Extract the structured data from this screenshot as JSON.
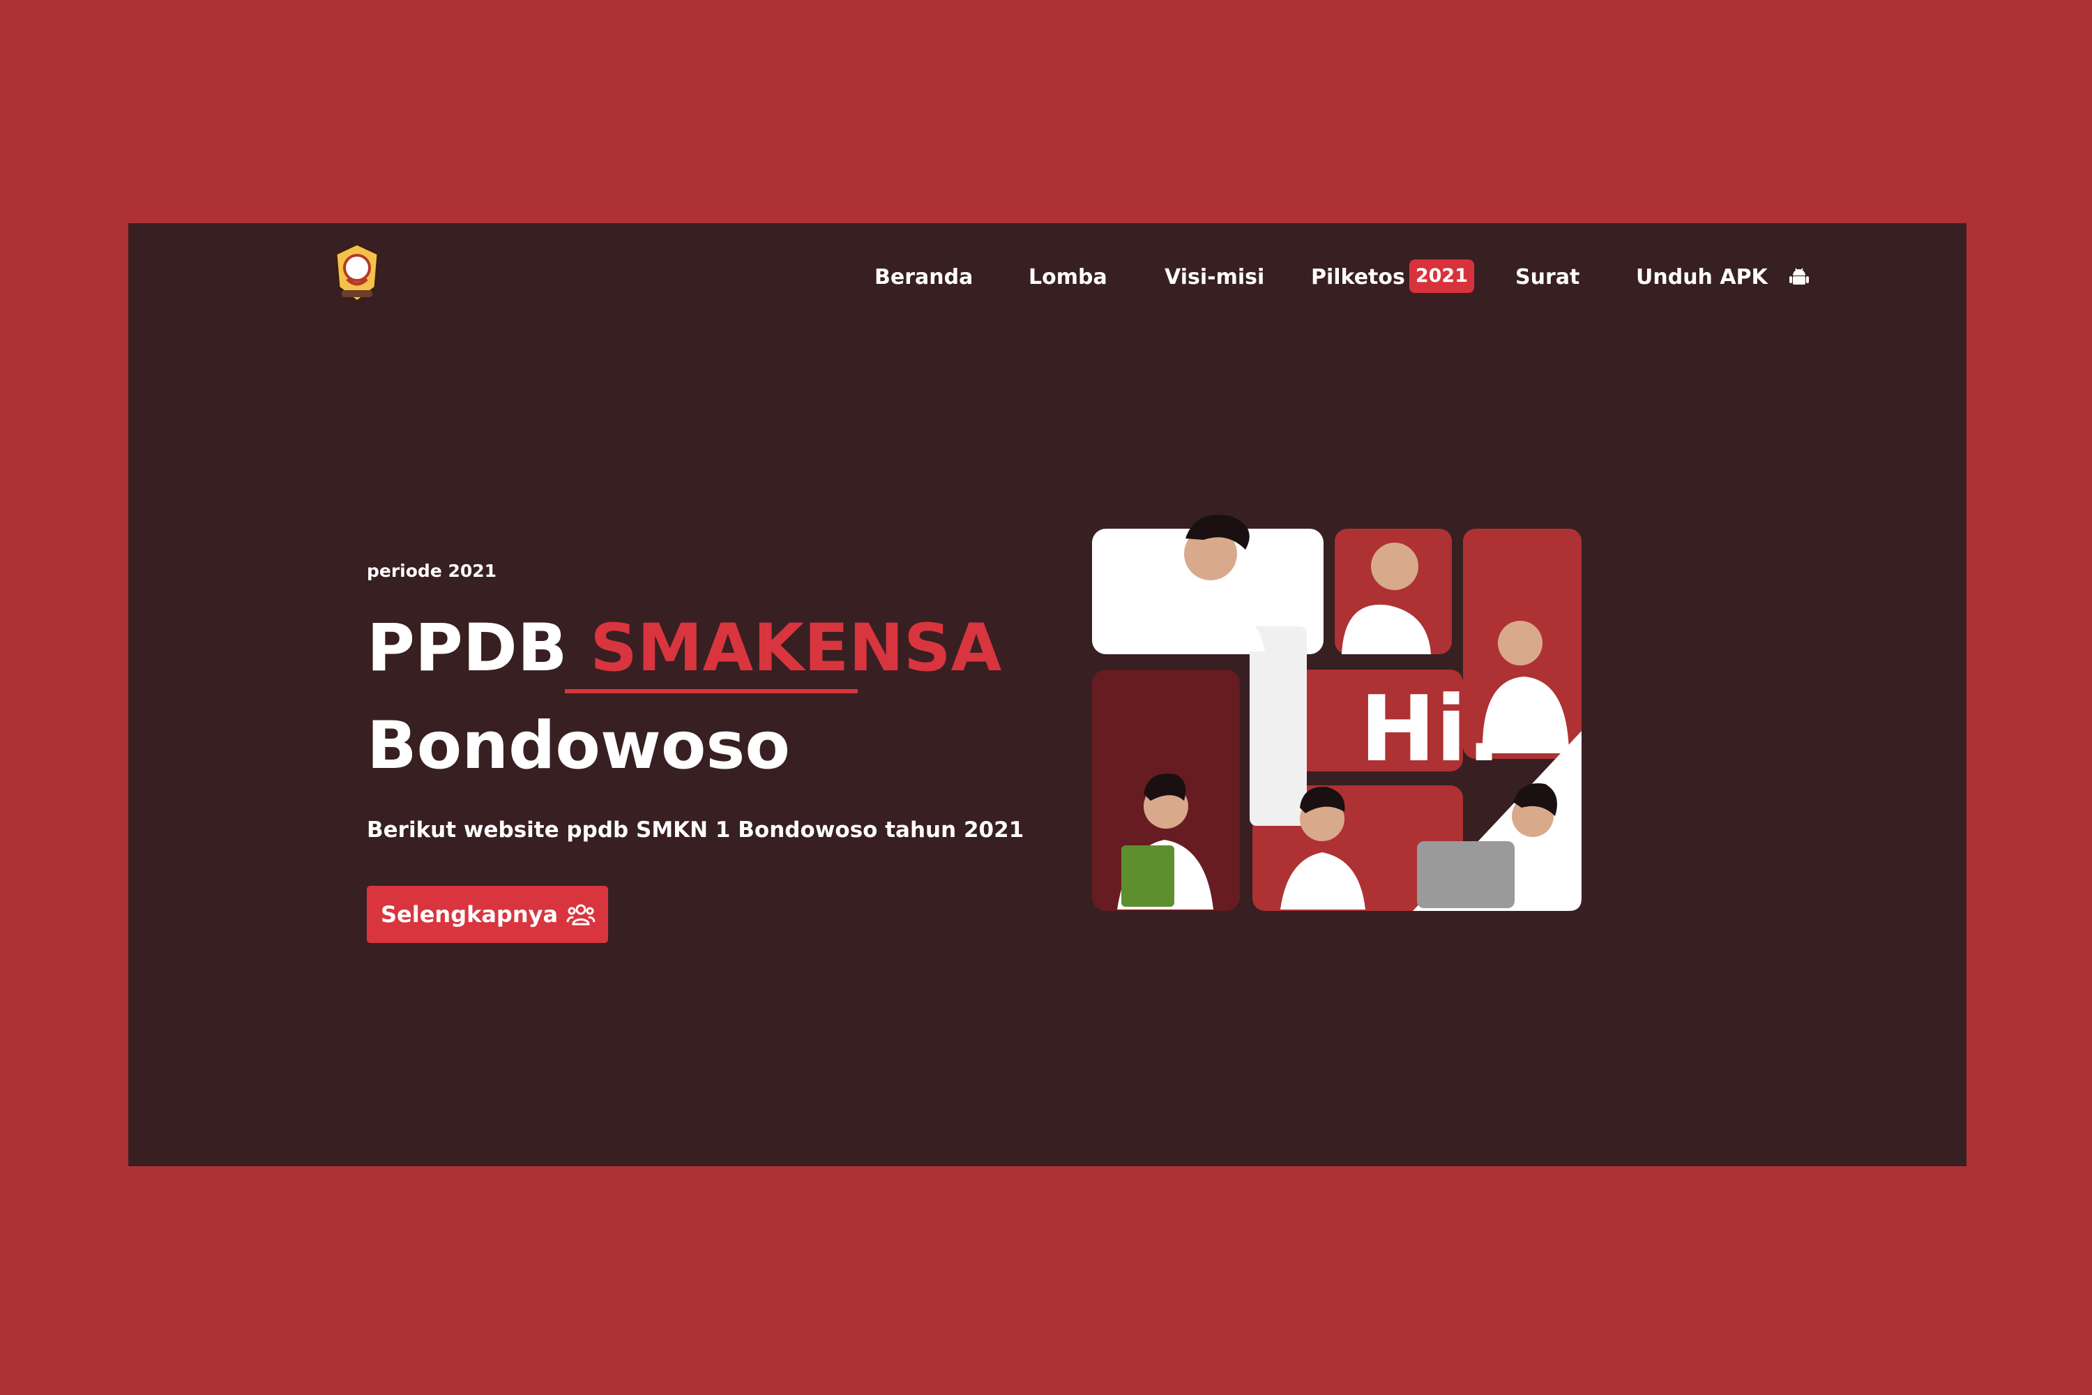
{
  "header": {
    "logo_icon": "school-emblem-icon",
    "nav": [
      {
        "label": "Beranda"
      },
      {
        "label": "Lomba"
      },
      {
        "label": "Visi-misi"
      },
      {
        "label": "Pilketos",
        "badge": "2021"
      },
      {
        "label": "Surat"
      },
      {
        "label": "Unduh APK",
        "icon": "android-icon"
      }
    ]
  },
  "hero": {
    "eyebrow": "periode 2021",
    "title_prefix": "PPDB",
    "title_accent": "SMAKENSA",
    "title_suffix": "Bondowoso",
    "subtitle": "Berikut website ppdb SMKN 1 Bondowoso tahun 2021",
    "cta_label": "Selengkapnya",
    "cta_icon": "users-icon",
    "illustration_text": "Hi."
  },
  "colors": {
    "outer_background": "#ae3234",
    "page_background": "#381f22",
    "accent": "#d9353e",
    "text": "#ffffff"
  }
}
